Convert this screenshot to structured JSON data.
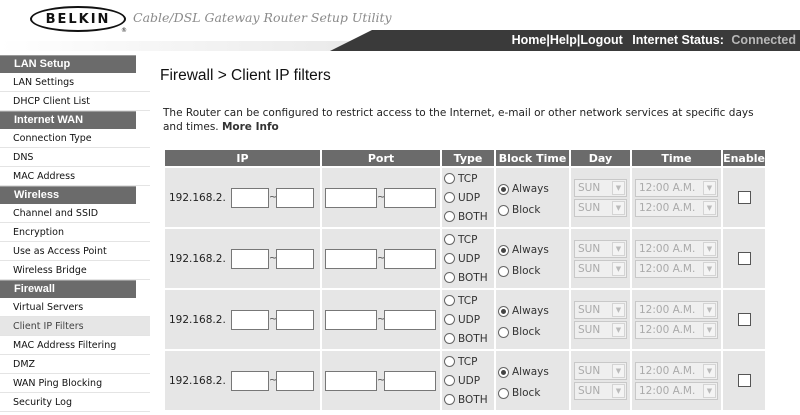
{
  "header": {
    "logo_text": "BELKIN",
    "logo_mark": "®",
    "app_title": "Cable/DSL Gateway Router Setup Utility",
    "links": [
      "Home",
      "Help",
      "Logout"
    ],
    "status_label": "Internet Status:",
    "status_value": "Connected",
    "colors": {
      "bar_dark": "#3a3a3a",
      "bar_light": "#d8d8d8"
    }
  },
  "sidebar": {
    "sections": [
      {
        "title": "LAN Setup",
        "items": [
          "LAN Settings",
          "DHCP Client List"
        ]
      },
      {
        "title": "Internet WAN",
        "items": [
          "Connection Type",
          "DNS",
          "MAC Address"
        ]
      },
      {
        "title": "Wireless",
        "items": [
          "Channel and SSID",
          "Encryption",
          "Use as Access Point",
          "Wireless Bridge"
        ]
      },
      {
        "title": "Firewall",
        "items": [
          "Virtual Servers",
          "Client IP Filters",
          "MAC Address Filtering",
          "DMZ",
          "WAN Ping Blocking",
          "Security Log"
        ]
      }
    ],
    "active_item": "Client IP Filters"
  },
  "main": {
    "title": "Firewall > Client IP filters",
    "description": "The Router can be configured to restrict access to the Internet, e-mail or other network services at specific days and times.",
    "more_info": "More Info",
    "table": {
      "headers": {
        "ip": "IP",
        "port": "Port",
        "type": "Type",
        "block_time": "Block Time",
        "day": "Day",
        "time": "Time",
        "enable": "Enable"
      },
      "ip_prefix": "192.168.2.",
      "range_sep": "~",
      "type_options": [
        "TCP",
        "UDP",
        "BOTH"
      ],
      "block_options": [
        "Always",
        "Block"
      ],
      "day_value": "SUN",
      "time_value": "12:00 A.M.",
      "rows": [
        {
          "type_selected": "",
          "block_selected": "Always",
          "enabled": false
        },
        {
          "type_selected": "",
          "block_selected": "Always",
          "enabled": false
        },
        {
          "type_selected": "",
          "block_selected": "Always",
          "enabled": false
        },
        {
          "type_selected": "",
          "block_selected": "Always",
          "enabled": false
        }
      ]
    }
  }
}
